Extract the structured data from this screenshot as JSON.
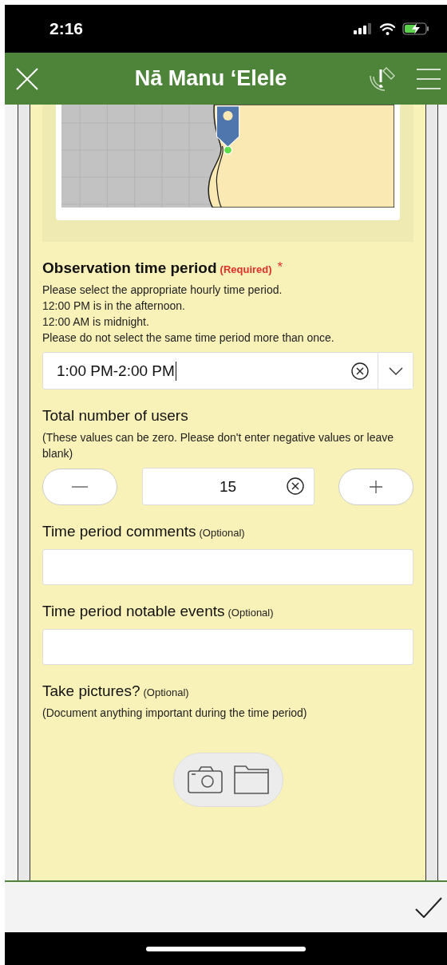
{
  "status_bar": {
    "time": "2:16"
  },
  "header": {
    "title": "Nā Manu ʻElele"
  },
  "questions": [
    {
      "kind": "select",
      "label": "Observation time period",
      "qualifier": "(Required)",
      "required_mark": "*",
      "hint": [
        "Please select the appropriate hourly time period.",
        "12:00 PM is in the afternoon.",
        "12:00 AM is midnight.",
        "Please do not select the same time period more than once."
      ],
      "value": "1:00 PM-2:00 PM",
      "focused": true
    },
    {
      "kind": "stepper",
      "label": "Total number of users",
      "hint": [
        "(These values can be zero. Please don't enter negative values or leave blank)"
      ],
      "value": "15"
    },
    {
      "kind": "text",
      "label": "Time period comments",
      "qualifier": "(Optional)"
    },
    {
      "kind": "text",
      "label": "Time period notable events",
      "qualifier": "(Optional)"
    },
    {
      "kind": "photo",
      "label": "Take pictures?",
      "qualifier": "(Optional)",
      "hint": [
        "(Document anything important during the time period)"
      ]
    }
  ]
}
